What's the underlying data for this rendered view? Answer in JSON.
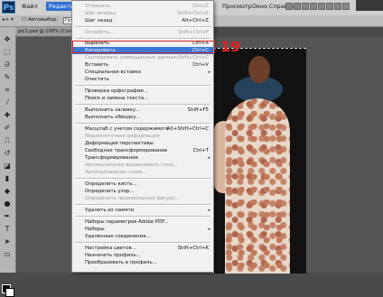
{
  "app": {
    "logo": "Ps"
  },
  "menubar": {
    "items": [
      "Файл",
      "Редактирование",
      "Просмотр",
      "Окно",
      "Справка"
    ]
  },
  "options_bar": {
    "auto_select_label": "Автовыбор:",
    "select_value": "Групп"
  },
  "document_tab": {
    "title": "pic1.psd @ 100% (Слой 1, ..."
  },
  "edit_menu": {
    "items": [
      {
        "label": "Отменить",
        "shortcut": "Ctrl+Z",
        "disabled": true
      },
      {
        "label": "Шаг вперед",
        "shortcut": "Shift+Ctrl+Z",
        "disabled": true
      },
      {
        "label": "Шаг назад",
        "shortcut": "Alt+Ctrl+Z",
        "disabled": false
      },
      {
        "label": "Ослабить...",
        "shortcut": "Shift+Ctrl+F",
        "disabled": true
      },
      {
        "label": "Вырезать",
        "shortcut": "Ctrl+X",
        "disabled": false
      },
      {
        "label": "Копировать",
        "shortcut": "Ctrl+C",
        "disabled": false,
        "highlighted": true
      },
      {
        "label": "Скопировать совмещенные данные",
        "shortcut": "Shift+Ctrl+C",
        "disabled": true
      },
      {
        "label": "Вставить",
        "shortcut": "Ctrl+V",
        "disabled": false
      },
      {
        "label": "Специальная вставка",
        "shortcut": "",
        "disabled": false,
        "submenu": true
      },
      {
        "label": "Очистить",
        "shortcut": "",
        "disabled": false
      },
      {
        "label": "Проверка орфографии...",
        "shortcut": "",
        "disabled": false
      },
      {
        "label": "Поиск и замена текста...",
        "shortcut": "",
        "disabled": false
      },
      {
        "label": "Выполнить заливку...",
        "shortcut": "Shift+F5",
        "disabled": false
      },
      {
        "label": "Выполнить обводку...",
        "shortcut": "",
        "disabled": false
      },
      {
        "label": "Масштаб с учетом содержимого",
        "shortcut": "Alt+Shift+Ctrl+C",
        "disabled": false
      },
      {
        "label": "Марионеточная деформация",
        "shortcut": "",
        "disabled": true
      },
      {
        "label": "Деформация перспективы",
        "shortcut": "",
        "disabled": false
      },
      {
        "label": "Свободное трансформирование",
        "shortcut": "Ctrl+T",
        "disabled": false
      },
      {
        "label": "Трансформирование",
        "shortcut": "",
        "disabled": false,
        "submenu": true
      },
      {
        "label": "Автоматически выравнивать слои...",
        "shortcut": "",
        "disabled": true
      },
      {
        "label": "Автоналожение слоев...",
        "shortcut": "",
        "disabled": true
      },
      {
        "label": "Определить кисть...",
        "shortcut": "",
        "disabled": false
      },
      {
        "label": "Определить узор...",
        "shortcut": "",
        "disabled": false
      },
      {
        "label": "Определить произвольную фигуру...",
        "shortcut": "",
        "disabled": true
      },
      {
        "label": "Удалить из памяти",
        "shortcut": "",
        "disabled": false,
        "submenu": true
      },
      {
        "label": "Наборы параметров Adobe PDF...",
        "shortcut": "",
        "disabled": false
      },
      {
        "label": "Наборы",
        "shortcut": "",
        "disabled": false,
        "submenu": true
      },
      {
        "label": "Удаленные соединения...",
        "shortcut": "",
        "disabled": false
      },
      {
        "label": "Настройка цветов...",
        "shortcut": "Shift+Ctrl+K",
        "disabled": false
      },
      {
        "label": "Назначить профиль...",
        "shortcut": "",
        "disabled": false
      },
      {
        "label": "Преобразовать в профиль...",
        "shortcut": "",
        "disabled": false
      }
    ]
  },
  "annotation": {
    "step_number": "19",
    "color": "#e02020"
  },
  "colors": {
    "highlight": "#3a78d8",
    "menu_bg": "#f1f1f1",
    "menubar_bg": "#cfcfcf"
  }
}
